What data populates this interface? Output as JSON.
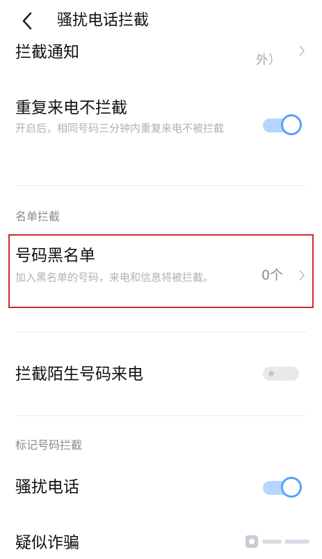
{
  "header": {
    "title": "骚扰电话拦截"
  },
  "rows": {
    "notify": {
      "title": "拦截通知",
      "value": "外）"
    },
    "repeat_call": {
      "title": "重复来电不拦截",
      "subtitle": "开启后，相同号码三分钟内重复来电不被拦截",
      "toggle": "on"
    },
    "section_list": "名单拦截",
    "blacklist": {
      "title": "号码黑名单",
      "subtitle": "加入黑名单的号码，来电和信息将被拦截。",
      "count": "0个"
    },
    "stranger": {
      "title": "拦截陌生号码来电",
      "toggle": "off"
    },
    "section_mark": "标记号码拦截",
    "harass": {
      "title": "骚扰电话",
      "toggle": "on"
    },
    "fraud": {
      "title": "疑似诈骗"
    }
  },
  "colors": {
    "accent": "#5aa0ff",
    "highlight_border": "#c92a2a"
  }
}
